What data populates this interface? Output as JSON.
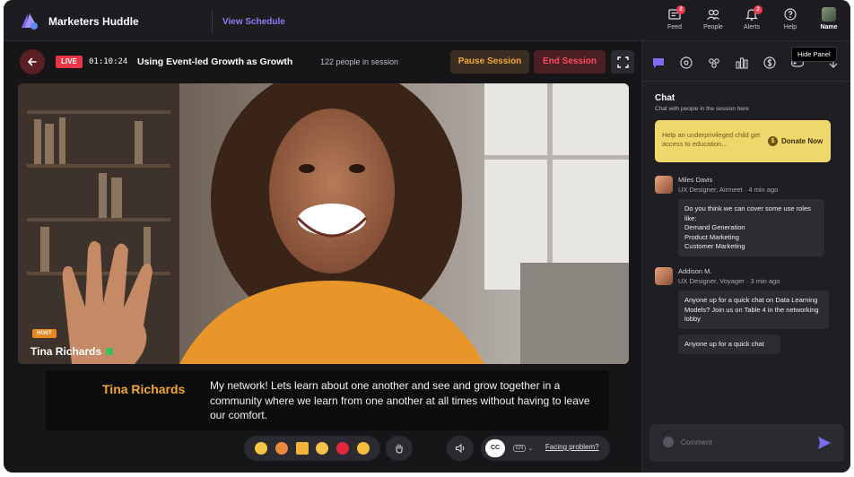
{
  "app": {
    "brand": "Marketers Huddle",
    "view_schedule": "View Schedule"
  },
  "topnav": [
    {
      "label": "Feed",
      "badge": "2",
      "icon": "feed-icon"
    },
    {
      "label": "People",
      "badge": "",
      "icon": "people-icon"
    },
    {
      "label": "Alerts",
      "badge": "2",
      "icon": "bell-icon"
    },
    {
      "label": "Help",
      "badge": "",
      "icon": "help-icon"
    },
    {
      "label": "Name",
      "badge": "",
      "icon": "avatar"
    }
  ],
  "session": {
    "live_label": "LIVE",
    "timer": "01:10:24",
    "title": "Using Event-led Growth as Growth",
    "people": "122 people in session",
    "pause_label": "Pause Session",
    "end_label": "End Session"
  },
  "video": {
    "host_tag": "HOST",
    "host_name": "Tina Richards"
  },
  "caption": {
    "speaker": "Tina Richards",
    "text": "My network! Lets learn about one another and see and grow together in a community where we learn from one another at all times without having to leave our comfort."
  },
  "controls": {
    "reactions": [
      "sunglasses-emoji",
      "party-emoji",
      "trophy-emoji",
      "thumbs-up-emoji",
      "heart-emoji",
      "clap-emoji"
    ],
    "cc_label": "CC",
    "lang_label": "EN",
    "facing_problem": "Facing problem?"
  },
  "panel": {
    "hide_panel": "Hide Panel",
    "tabs": [
      "chat-icon",
      "qna-icon",
      "people-group-icon",
      "poll-icon",
      "dollar-icon",
      "games-icon",
      "more-icon"
    ],
    "chat_title": "Chat",
    "chat_sub": "Chat with people in the session here",
    "donate_text": "Help an underprivileged child get access to education...",
    "donate_button": "Donate Now",
    "messages": [
      {
        "name": "Miles Davis",
        "role": "UX Designer, Airmeet · 4 min ago",
        "bubbles": [
          "Do you think we can cover some use roles like:\n Demand Generation\n Product Marketing\n Customer Marketing"
        ]
      },
      {
        "name": "Addison M.",
        "role": "UX Designer, Voyager · 3 min ago",
        "bubbles": [
          "Anyone up for a quick chat on Data Learning Models? Join us on Table 4 in the networking lobby",
          "Anyone up for a quick chat"
        ]
      }
    ],
    "composer_placeholder": "Comment"
  },
  "colors": {
    "accent_orange": "#f4a62a",
    "live_red": "#e83646",
    "brand_purple": "#8b7cf6",
    "send_purple": "#7a6cf0"
  }
}
